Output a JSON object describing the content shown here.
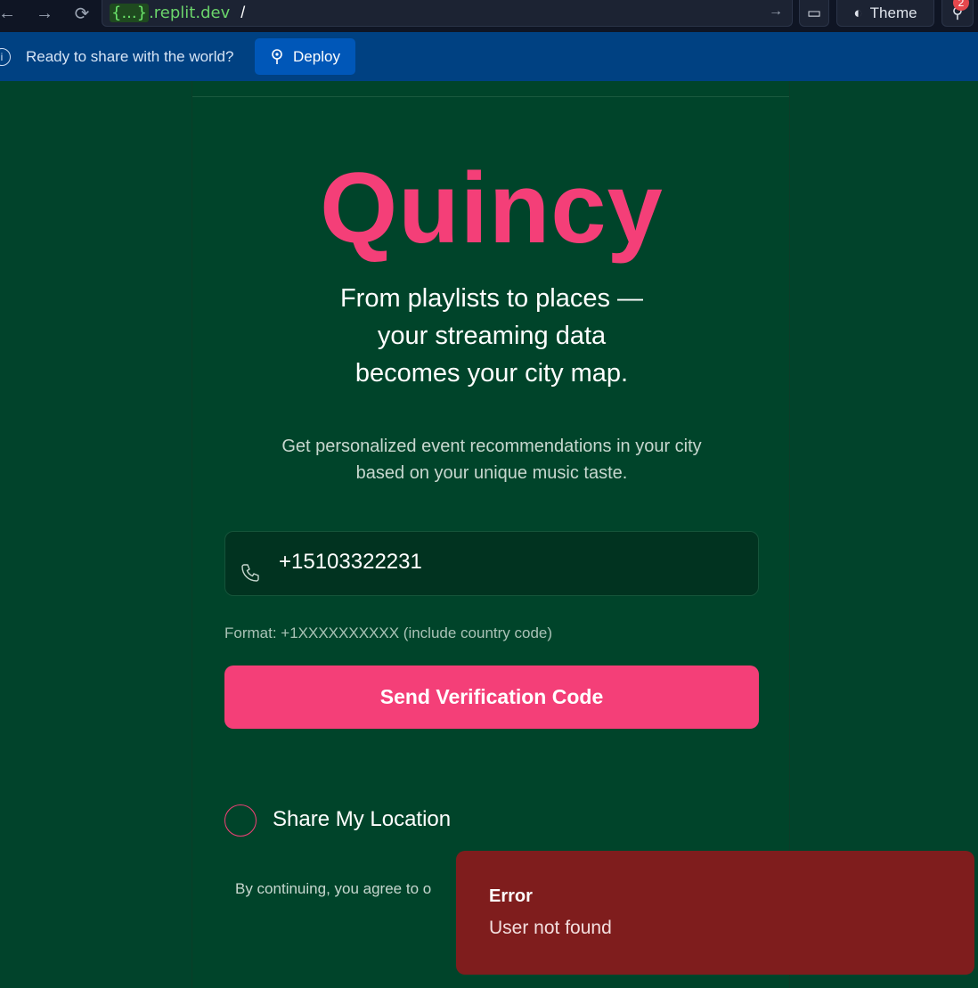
{
  "browser": {
    "url_curly": "{...}",
    "url_domain": ".replit.dev",
    "url_path": "/",
    "theme_label": "Theme",
    "badge_count": "2"
  },
  "banner": {
    "text": "Ready to share with the world?",
    "deploy_label": "Deploy"
  },
  "app": {
    "logo": "Quincy",
    "tagline_line1": "From playlists to places —",
    "tagline_line2": "your streaming data",
    "tagline_line3": "becomes your city map.",
    "desc_line1": "Get personalized event recommendations in your city",
    "desc_line2": "based on your unique music taste.",
    "phone_value": "+15103322231",
    "format_hint": "Format: +1XXXXXXXXXX (include country code)",
    "send_button": "Send Verification Code",
    "share_location": "Share My Location",
    "terms_partial": "By continuing, you agree to o"
  },
  "toast": {
    "title": "Error",
    "message": "User not found"
  },
  "colors": {
    "background": "#01432b",
    "accent": "#f43f78",
    "banner": "#004182",
    "toast": "#7f1d1d"
  }
}
